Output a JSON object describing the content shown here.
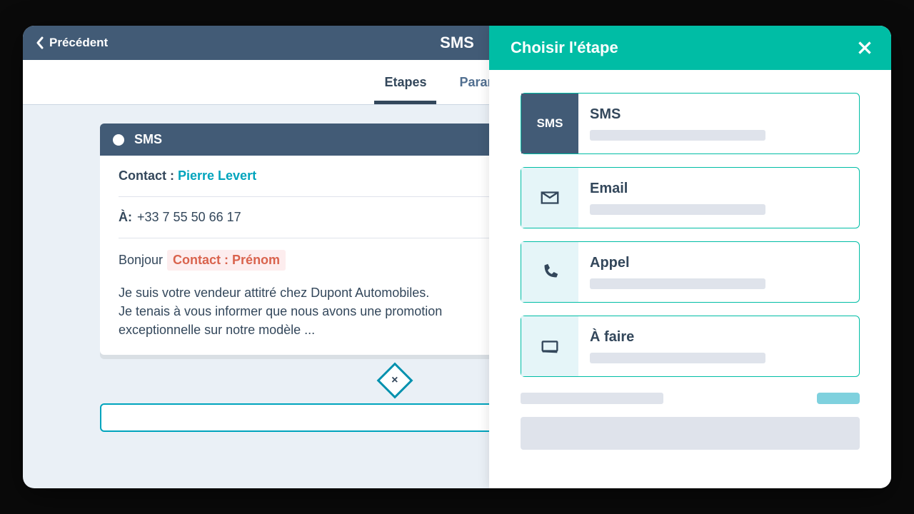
{
  "header": {
    "back": "Précédent",
    "title": "SMS"
  },
  "tabs": {
    "steps": "Etapes",
    "settings": "Paramètres"
  },
  "card": {
    "headLabel": "SMS",
    "contactLabel": "Contact : ",
    "contactName": "Pierre Levert",
    "toLabel": "À:",
    "toValue": "+33 7 55 50 66 17",
    "greeting": "Bonjour",
    "token": "Contact : Prénom",
    "messageBody": "Je suis votre vendeur attitré chez Dupont Automobiles.\nJe tenais à vous informer que nous avons une promotion exceptionnelle sur notre modèle ...",
    "diamondClose": "×"
  },
  "panel": {
    "title": "Choisir l'étape",
    "options": [
      {
        "label": "SMS",
        "iconType": "text",
        "iconValue": "SMS",
        "selected": true
      },
      {
        "label": "Email",
        "iconType": "envelope",
        "selected": false
      },
      {
        "label": "Appel",
        "iconType": "phone",
        "selected": false
      },
      {
        "label": "À faire",
        "iconType": "todo",
        "selected": false
      }
    ]
  }
}
